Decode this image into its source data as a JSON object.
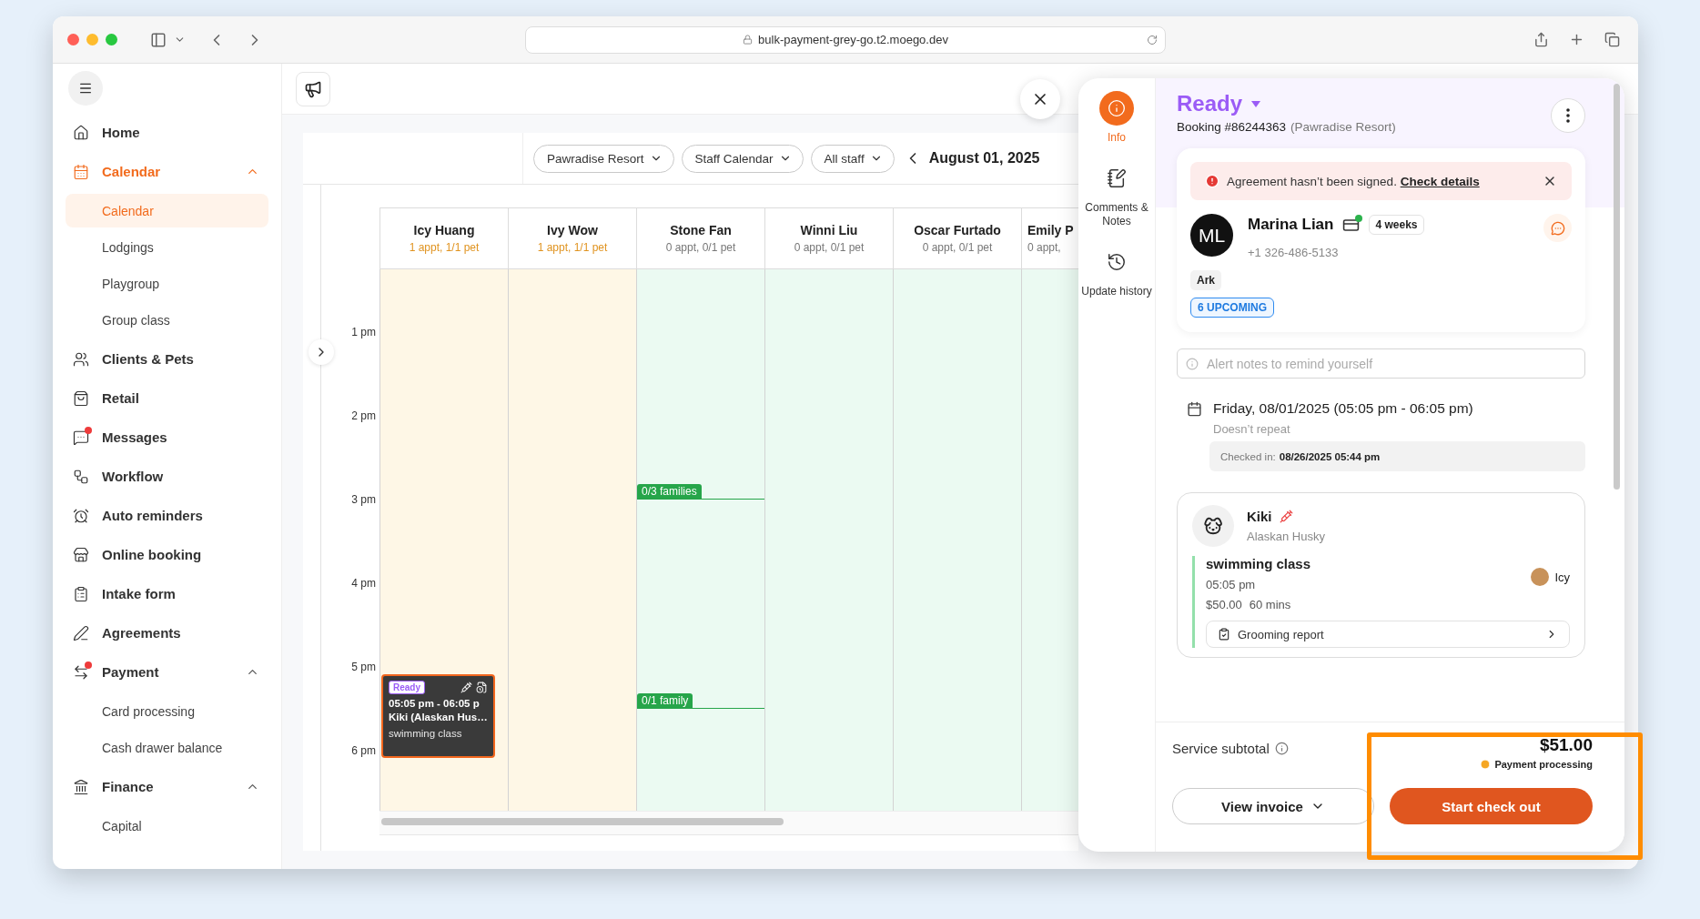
{
  "browser": {
    "url": "bulk-payment-grey-go.t2.moego.dev"
  },
  "sidebar": {
    "items": [
      {
        "label": "Home",
        "selected": false,
        "unread": false
      },
      {
        "label": "Calendar",
        "selected": true,
        "unread": false,
        "expanded": true,
        "children": [
          {
            "label": "Calendar",
            "selected": true
          },
          {
            "label": "Lodgings",
            "selected": false
          },
          {
            "label": "Playgroup",
            "selected": false
          },
          {
            "label": "Group class",
            "selected": false
          }
        ]
      },
      {
        "label": "Clients & Pets",
        "selected": false,
        "unread": false
      },
      {
        "label": "Retail",
        "selected": false,
        "unread": false
      },
      {
        "label": "Messages",
        "selected": false,
        "unread": true
      },
      {
        "label": "Workflow",
        "selected": false,
        "unread": false
      },
      {
        "label": "Auto reminders",
        "selected": false,
        "unread": false
      },
      {
        "label": "Online booking",
        "selected": false,
        "unread": false
      },
      {
        "label": "Intake form",
        "selected": false,
        "unread": false
      },
      {
        "label": "Agreements",
        "selected": false,
        "unread": false
      },
      {
        "label": "Payment",
        "selected": false,
        "unread": true,
        "expanded": true,
        "children": [
          {
            "label": "Card processing",
            "selected": false
          },
          {
            "label": "Cash drawer balance",
            "selected": false
          }
        ]
      },
      {
        "label": "Finance",
        "selected": false,
        "unread": false,
        "expanded": true,
        "children": [
          {
            "label": "Capital",
            "selected": false
          }
        ]
      }
    ]
  },
  "calendar": {
    "filters": [
      "Pawradise Resort",
      "Staff Calendar",
      "All staff"
    ],
    "date": "August 01, 2025",
    "hours": [
      "1 pm",
      "2 pm",
      "3 pm",
      "4 pm",
      "5 pm",
      "6 pm"
    ],
    "staff": [
      {
        "name": "Icy Huang",
        "summary": "1 appt, 1/1 pet",
        "has_appointments": true,
        "appointments": [
          {
            "status": "Ready",
            "time": "05:05 pm - 06:05 p",
            "pet": "Kiki  (Alaskan Hus…",
            "service": "swimming class"
          }
        ]
      },
      {
        "name": "Ivy Wow",
        "summary": "1 appt, 1/1 pet",
        "has_appointments": true
      },
      {
        "name": "Stone Fan",
        "summary": "0 appt, 0/1 pet",
        "has_appointments": false,
        "markers": [
          {
            "label": "0/3 families"
          },
          {
            "label": "0/1 family"
          }
        ]
      },
      {
        "name": "Winni Liu",
        "summary": "0 appt, 0/1 pet",
        "has_appointments": false
      },
      {
        "name": "Oscar Furtado",
        "summary": "0 appt, 0/1 pet",
        "has_appointments": false
      },
      {
        "name": "Emily P",
        "summary": "0 appt,",
        "has_appointments": false
      }
    ]
  },
  "drawer": {
    "tabs": [
      {
        "label": "Info",
        "selected": true
      },
      {
        "label": "Comments & Notes",
        "selected": false
      },
      {
        "label": "Update history",
        "selected": false
      }
    ],
    "status": "Ready",
    "booking": "Booking #86244363",
    "location": "(Pawradise Resort)",
    "alert": {
      "text": "Agreement hasn’t been signed.",
      "link": "Check details"
    },
    "client": {
      "initials": "ML",
      "name": "Marina Lian",
      "frequency": "4 weeks",
      "phone": "+1 326-486-5133",
      "tags": [
        "Ark"
      ],
      "upcoming": "6 UPCOMING"
    },
    "alert_notes": {
      "placeholder": "Alert notes to remind yourself"
    },
    "schedule": {
      "date": "Friday, 08/01/2025",
      "time": "(05:05 pm - 06:05 pm)",
      "repeat": "Doesn’t repeat",
      "checked_in_label": "Checked in:",
      "checked_in_value": "08/26/2025 05:44 pm"
    },
    "pet": {
      "name": "Kiki",
      "breed": "Alaskan Husky",
      "service": "swimming class",
      "time": "05:05 pm",
      "price": "$50.00",
      "duration": "60 mins",
      "staff": "Icy",
      "report": "Grooming report"
    },
    "footer": {
      "subtotal_label": "Service subtotal",
      "total": "$51.00",
      "payment_status": "Payment processing",
      "view_invoice": "View invoice",
      "checkout": "Start check out"
    }
  }
}
